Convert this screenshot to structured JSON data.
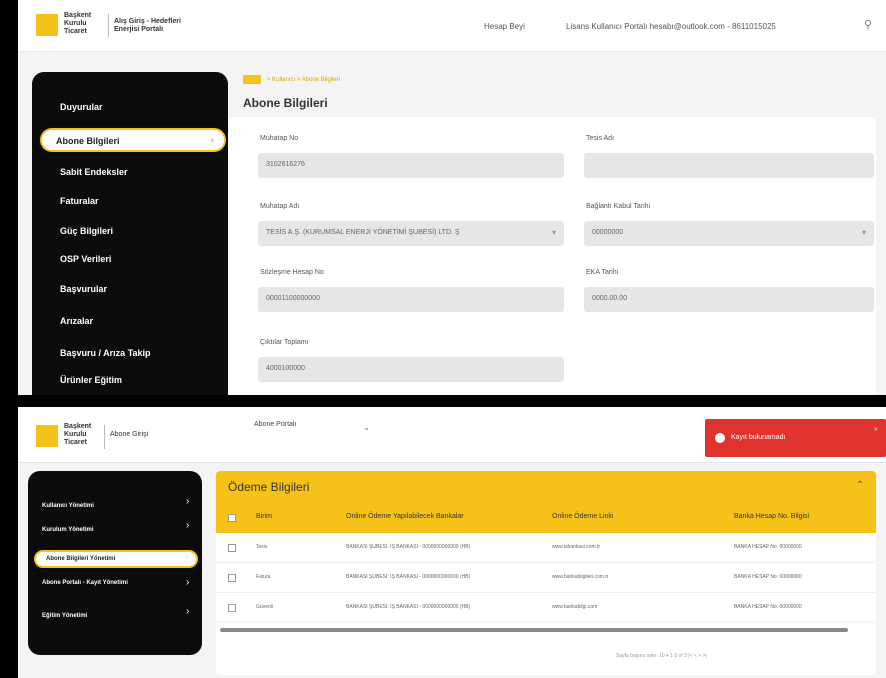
{
  "top": {
    "logo_text": "Başkent\nKurulu\nTicaret",
    "logo_sub": "Alış Giriş - Hedefleri\nEnerjisi Portalı",
    "user_name": "Hesap Beyi",
    "user_info": "Lisans Kullanıcı Portalı hesabı@outlook.com - 8611015025"
  },
  "sidebar": {
    "items": [
      "Duyurular",
      "Abone Bilgileri",
      "Sabit Endeksler",
      "Faturalar",
      "Güç Bilgileri",
      "OSP Verileri",
      "Başvurular",
      "Arızalar",
      "Başvuru / Arıza Takip",
      "Ürünler Eğitim"
    ],
    "active_index": 1
  },
  "breadcrumb": {
    "path": "> Kullanıcı > Abone Bilgileri"
  },
  "page_title": "Abone Bilgileri",
  "form": {
    "fields": [
      {
        "label": "Muhatap No",
        "value": "3102616276"
      },
      {
        "label": "Tesis Adı",
        "value": ""
      },
      {
        "label": "Muhatap Adı",
        "value": "TESİS A.Ş. (KURUMSAL ENERJİ YÖNETİMİ ŞUBESİ) LTD. Ş"
      },
      {
        "label": "Bağlantı Kabul Tarihi",
        "value": "00000000"
      },
      {
        "label": "Sözleşme Hesap No",
        "value": "00001100000000"
      },
      {
        "label": "EKA Tarihi",
        "value": "0000.00.00"
      },
      {
        "label": "Çıktılar Toplamı",
        "value": "4000100000"
      }
    ]
  },
  "panel2": {
    "top_select": "Abone Portalı",
    "logo_text": "Başkent\nKurulu\nTicaret",
    "logo_sub": "Abone Girişi",
    "toast": "Kayıt bulunamadı",
    "sidebar_items": [
      "Kullanıcı Yönetimi",
      "Kurulum Yönetimi",
      "Abone Bilgileri Yönetimi",
      "Abone Portalı - Kayıt Yönetimi",
      "Eğitim Yönetimi"
    ],
    "table_title": "Ödeme Bilgileri",
    "columns": [
      "Birim",
      "Online Ödeme Yapılabilecek Bankalar",
      "Online Ödeme Linki",
      "Banka Hesap No. Bilgisi"
    ],
    "rows": [
      [
        "Tesis",
        "BANKASI ŞUBESİ: İŞ BANKASI - 0000000000000 (HB)",
        "www.isbankasi.com.tr",
        "BANKA HESAP No: 00000000"
      ],
      [
        "Fatura",
        "BANKASI ŞUBESİ: İŞ BANKASI - 0000000000000 (HB)",
        "www.bankabilgileri.com.tr",
        "BANKA HESAP No: 00000000"
      ],
      [
        "Güvenli",
        "BANKASI ŞUBESİ: İŞ BANKASI - 0000000000000 (HB)",
        "www.bankabilgi.com",
        "BANKA HESAP No: 00000000"
      ]
    ],
    "pager": "Sayfa başına satır: 10 ▾   1-3 of 3   |<   <   >   >|"
  }
}
